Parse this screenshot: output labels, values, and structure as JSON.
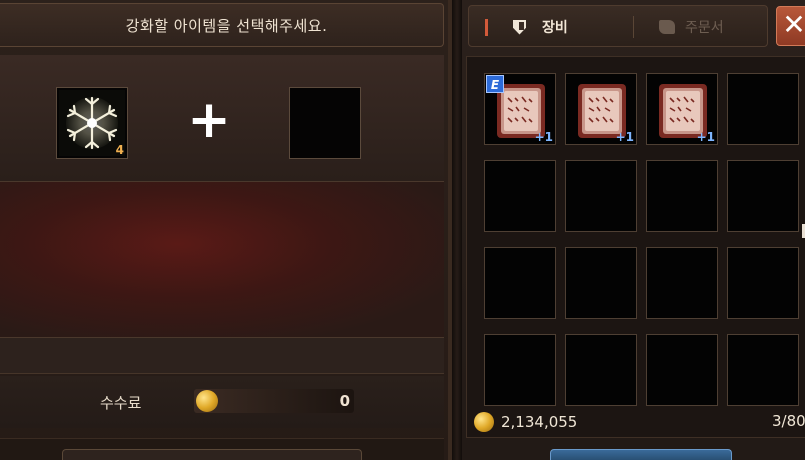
{
  "enhance": {
    "header_text": "강화할 아이템을 선택해주세요.",
    "source_slot": {
      "icon": "snowflake-icon",
      "count": "4"
    },
    "plus_symbol": "+",
    "fee_label": "수수료",
    "fee_value": "0"
  },
  "inventory": {
    "tabs": [
      {
        "label": "장비",
        "icon": "shield-icon",
        "active": true
      },
      {
        "label": "주문서",
        "icon": "scroll-icon",
        "active": false
      }
    ],
    "close_label": "✕",
    "items": [
      {
        "icon": "spellbook-icon",
        "enhance": "+1",
        "equipped_badge": "E"
      },
      {
        "icon": "spellbook-icon",
        "enhance": "+1",
        "equipped_badge": ""
      },
      {
        "icon": "spellbook-icon",
        "enhance": "+1",
        "equipped_badge": ""
      }
    ],
    "gold": "2,134,055",
    "capacity": "3/80"
  },
  "colors": {
    "accent_red": "#d25a3a",
    "gold": "#e0a928",
    "enhance_blue": "#7fb6ff"
  }
}
